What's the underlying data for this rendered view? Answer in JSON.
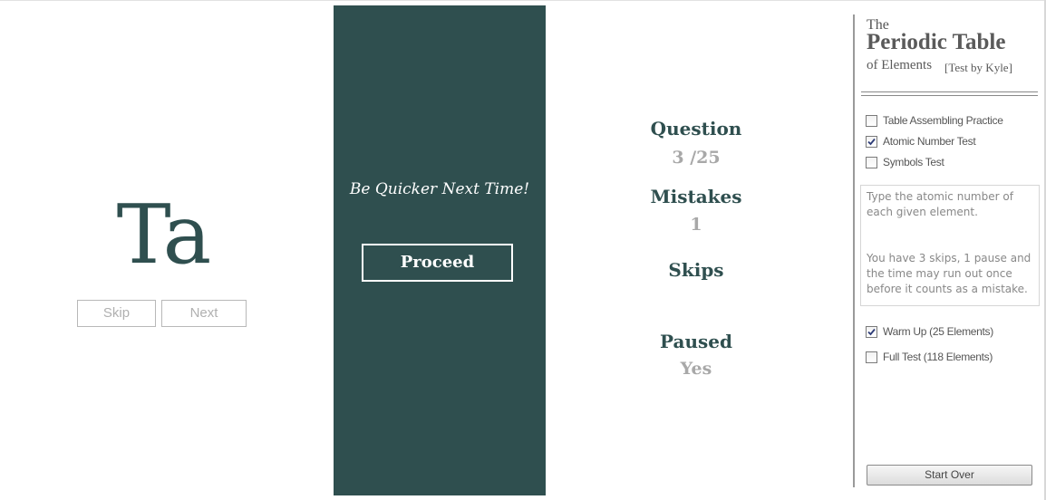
{
  "quiz": {
    "symbol": "Ta",
    "skip_label": "Skip",
    "next_label": "Next"
  },
  "panel": {
    "message": "Be Quicker Next Time!",
    "proceed_label": "Proceed"
  },
  "stats": {
    "question_label": "Question",
    "question_value": "3 /25",
    "mistakes_label": "Mistakes",
    "mistakes_value": "1",
    "skips_label": "Skips",
    "skips_value": "",
    "paused_label": "Paused",
    "paused_value": "Yes"
  },
  "sidebar": {
    "title_the": "The",
    "title_main": "Periodic Table",
    "title_sub": "of Elements",
    "title_author": "[Test by Kyle]",
    "modes": [
      {
        "label": "Table Assembling Practice",
        "checked": false
      },
      {
        "label": "Atomic Number Test",
        "checked": true
      },
      {
        "label": "Symbols Test",
        "checked": false
      }
    ],
    "description_1": "Type the atomic number of each given element.",
    "description_2": "You have 3 skips, 1 pause and the time may run out once before it counts as a mistake.",
    "sizes": [
      {
        "label": "Warm Up (25 Elements)",
        "checked": true
      },
      {
        "label": "Full Test (118 Elements)",
        "checked": false
      }
    ],
    "start_over_label": "Start Over"
  },
  "colors": {
    "primary": "#2f4f4f",
    "muted": "#a8a8a8",
    "panel_text": "#ffffff"
  }
}
